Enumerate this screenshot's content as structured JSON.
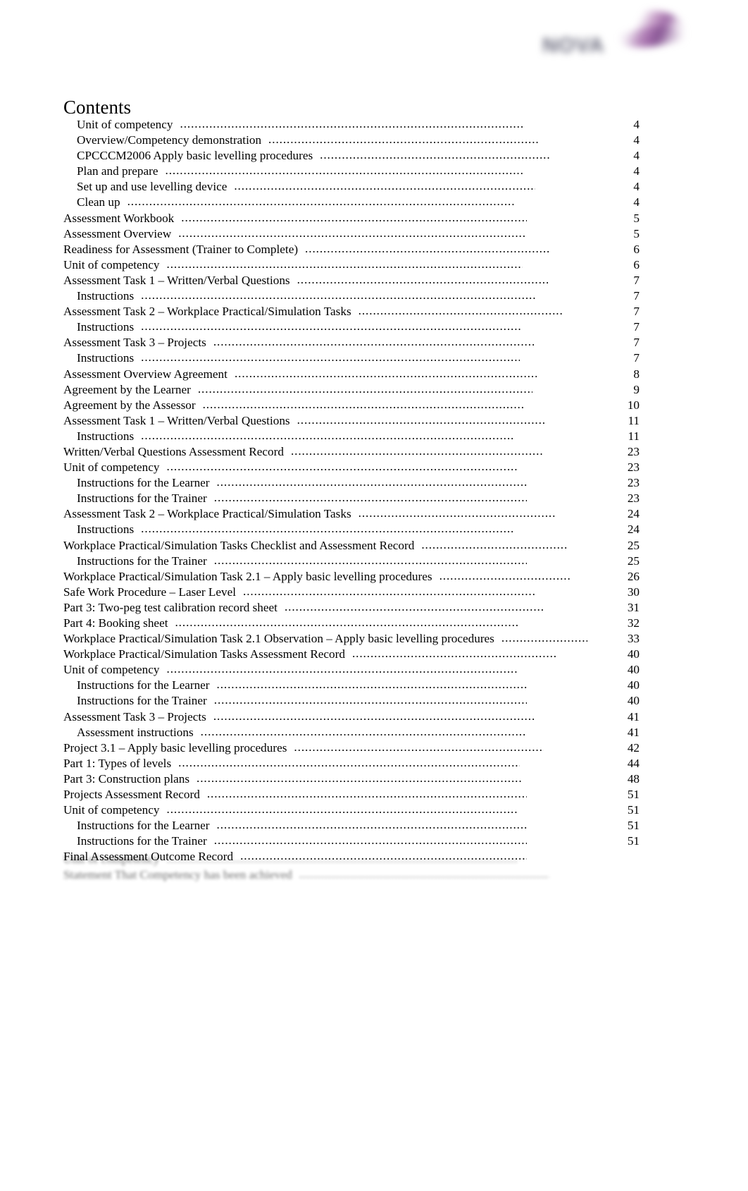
{
  "brand": {
    "logo_wordmark": "NOVA",
    "logo_icon": "swoosh-mark"
  },
  "page": {
    "heading": "Contents"
  },
  "toc": {
    "entries": [
      {
        "label": "Unit of competency",
        "page": "4",
        "level": 2,
        "tail": 118
      },
      {
        "label": "Overview/Competency demonstration",
        "page": "4",
        "level": 2,
        "tail": 94
      },
      {
        "label": "CPCCCM2006 Apply basic levelling procedures",
        "page": "4",
        "level": 2,
        "tail": 78
      },
      {
        "label": "Plan and prepare",
        "page": "4",
        "level": 3,
        "tail": 118
      },
      {
        "label": "Set up and use levelling device",
        "page": "4",
        "level": 3,
        "tail": 100
      },
      {
        "label": "Clean up",
        "page": "4",
        "level": 3,
        "tail": 130
      },
      {
        "label": "Assessment Workbook",
        "page": "5",
        "level": 1,
        "tail": 112
      },
      {
        "label": "Assessment Overview",
        "page": "5",
        "level": 1,
        "tail": 114
      },
      {
        "label": "Readiness for Assessment (Trainer to Complete)",
        "page": "6",
        "level": 1,
        "tail": 78
      },
      {
        "label": "Unit of competency",
        "page": "6",
        "level": 1,
        "tail": 118
      },
      {
        "label": "Assessment Task 1    – Written/Verbal Questions",
        "page": "7",
        "level": 1,
        "tail": 82
      },
      {
        "label": "Instructions",
        "page": "7",
        "level": 3,
        "tail": 100
      },
      {
        "label": "Assessment Task 2    – Workplace Practical/Simulation Tasks",
        "page": "7",
        "level": 1,
        "tail": 62
      },
      {
        "label": "Instructions",
        "page": "7",
        "level": 3,
        "tail": 120
      },
      {
        "label": "Assessment Task 3    – Projects",
        "page": "7",
        "level": 1,
        "tail": 102
      },
      {
        "label": "Instructions",
        "page": "7",
        "level": 3,
        "tail": 122
      },
      {
        "label": "Assessment Overview Agreement",
        "page": "8",
        "level": 1,
        "tail": 98
      },
      {
        "label": "Agreement by the Learner",
        "page": "9",
        "level": 1,
        "tail": 104
      },
      {
        "label": "Agreement by the Assessor",
        "page": "10",
        "level": 1,
        "tail": 114
      },
      {
        "label": "Assessment Task 1    – Written/Verbal Questions",
        "page": "11",
        "level": 1,
        "tail": 86
      },
      {
        "label": "Instructions",
        "page": "11",
        "level": 3,
        "tail": 132
      },
      {
        "label": "Written/Verbal Questions Assessment Record",
        "page": "23",
        "level": 1,
        "tail": 88
      },
      {
        "label": "Unit of competency",
        "page": "23",
        "level": 1,
        "tail": 124
      },
      {
        "label": "Instructions for the Learner",
        "page": "23",
        "level": 3,
        "tail": 112
      },
      {
        "label": "Instructions for the Trainer",
        "page": "23",
        "level": 3,
        "tail": 112
      },
      {
        "label": "Assessment Task 2    – Workplace Practical/Simulation Tasks",
        "page": "24",
        "level": 1,
        "tail": 72
      },
      {
        "label": "Instructions",
        "page": "24",
        "level": 3,
        "tail": 132
      },
      {
        "label": "Workplace Practical/Simulation Tasks Checklist and Assessment Record",
        "page": "25",
        "level": 1,
        "tail": 54
      },
      {
        "label": "Instructions for the Trainer",
        "page": "25",
        "level": 3,
        "tail": 112
      },
      {
        "label": "Workplace Practical/Simulation Task 2.1       – Apply basic levelling procedures",
        "page": "26",
        "level": 1,
        "tail": 50
      },
      {
        "label": "Safe Work Procedure    – Laser Level",
        "page": "30",
        "level": 1,
        "tail": 100
      },
      {
        "label": "Part 3: Two-peg test calibration record sheet",
        "page": "31",
        "level": 1,
        "tail": 86
      },
      {
        "label": "Part 4: Booking sheet",
        "page": "32",
        "level": 1,
        "tail": 122
      },
      {
        "label": "Workplace Practical/Simulation Task 2.1 Observation       – Apply basic levelling procedures",
        "page": "33",
        "level": 1,
        "tail": 26
      },
      {
        "label": "Workplace Practical/Simulation Tasks Assessment Record",
        "page": "40",
        "level": 1,
        "tail": 70
      },
      {
        "label": "Unit of competency",
        "page": "40",
        "level": 1,
        "tail": 124
      },
      {
        "label": "Instructions for the Learner",
        "page": "40",
        "level": 3,
        "tail": 112
      },
      {
        "label": "Instructions for the Trainer",
        "page": "40",
        "level": 3,
        "tail": 112
      },
      {
        "label": "Assessment Task 3    – Projects",
        "page": "41",
        "level": 1,
        "tail": 102
      },
      {
        "label": "Assessment instructions",
        "page": "41",
        "level": 3,
        "tail": 112
      },
      {
        "label": "Project 3.1   – Apply basic levelling procedures",
        "page": "42",
        "level": 1,
        "tail": 88
      },
      {
        "label": "Part 1: Types of levels",
        "page": "44",
        "level": 1,
        "tail": 122
      },
      {
        "label": "Part 3: Construction plans",
        "page": "48",
        "level": 1,
        "tail": 118
      },
      {
        "label": "Projects Assessment Record",
        "page": "51",
        "level": 1,
        "tail": 112
      },
      {
        "label": "Unit of competency",
        "page": "51",
        "level": 1,
        "tail": 124
      },
      {
        "label": "Instructions for the Learner",
        "page": "51",
        "level": 3,
        "tail": 112
      },
      {
        "label": "Instructions for the Trainer",
        "page": "51",
        "level": 3,
        "tail": 112
      },
      {
        "label": "Final Assessment Outcome Record",
        "page": "",
        "level": 1,
        "tail": 112
      }
    ],
    "faded_entries": [
      {
        "label": "Unit of competency",
        "page": "",
        "level": 1,
        "tail": 124
      },
      {
        "label": "Statement That Competency has been achieved",
        "page": "",
        "level": 1,
        "tail": 80
      }
    ]
  }
}
